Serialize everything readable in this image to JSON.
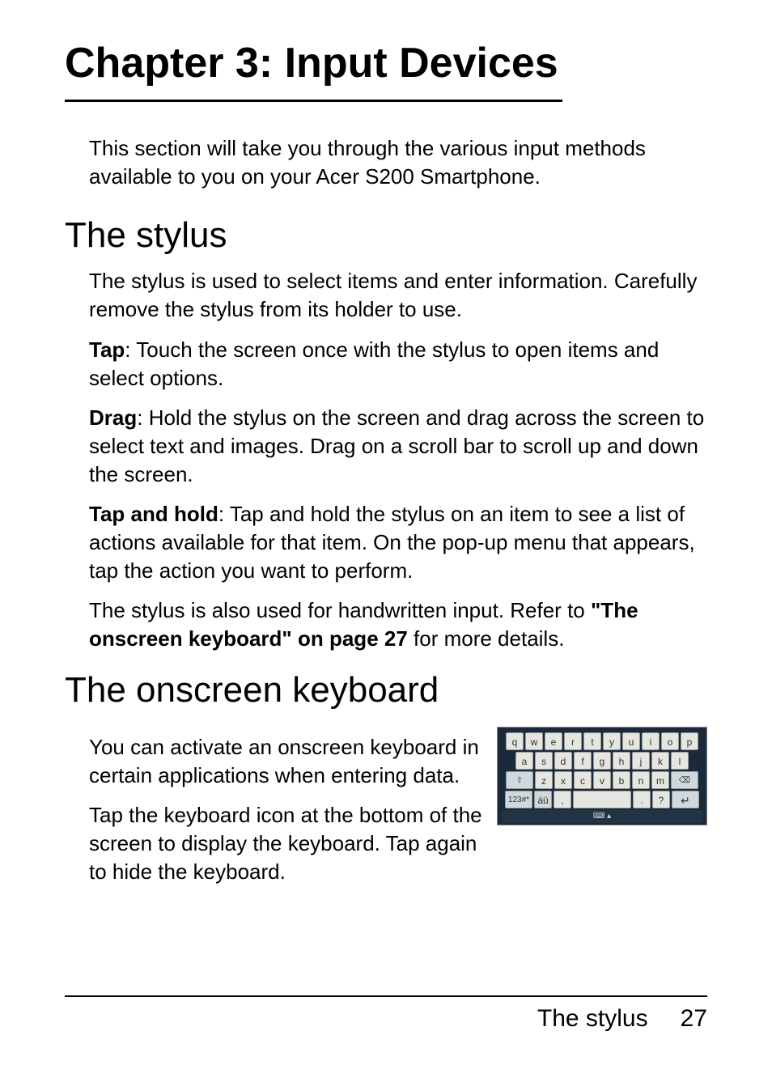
{
  "chapter_title": "Chapter 3: Input Devices",
  "intro": "This section will take you through the various input methods available to you on your Acer S200 Smartphone.",
  "section1": {
    "title": "The stylus",
    "p1": "The stylus is used to select items and enter information. Carefully remove the stylus from its holder to use.",
    "tap_label": "Tap",
    "tap_text": ": Touch the screen once with the stylus to open items and select options.",
    "drag_label": "Drag",
    "drag_text": ": Hold the stylus on the screen and drag across the screen to select text and images. Drag on a scroll bar to scroll up and down the screen.",
    "taphold_label": "Tap and hold",
    "taphold_text": ": Tap and hold the stylus on an item to see a list of actions available for that item. On the pop-up menu that appears, tap the action you want to perform.",
    "p5_a": "The stylus is also used for handwritten input. Refer to ",
    "p5_link": "\"The onscreen keyboard\" on page 27",
    "p5_b": " for more details."
  },
  "section2": {
    "title": "The onscreen keyboard",
    "p1": "You can activate an onscreen keyboard in certain applications when entering data.",
    "p2": "Tap the keyboard icon at the bottom of the screen to display the keyboard. Tap again to hide the keyboard."
  },
  "keyboard": {
    "row1": [
      "q",
      "w",
      "e",
      "r",
      "t",
      "y",
      "u",
      "i",
      "o",
      "p"
    ],
    "row2": [
      "a",
      "s",
      "d",
      "f",
      "g",
      "h",
      "j",
      "k",
      "l"
    ],
    "row3_shift": "⇧",
    "row3": [
      "z",
      "x",
      "c",
      "v",
      "b",
      "n",
      "m"
    ],
    "row3_back": "⌫",
    "row4_sym": "123#*",
    "row4_accent": "áü",
    "row4_comma": ",",
    "row4_period": ".",
    "row4_q": "?",
    "row4_enter": "↵",
    "footer_icon": "⌨ ▴"
  },
  "footer": {
    "title": "The stylus",
    "page": "27"
  }
}
